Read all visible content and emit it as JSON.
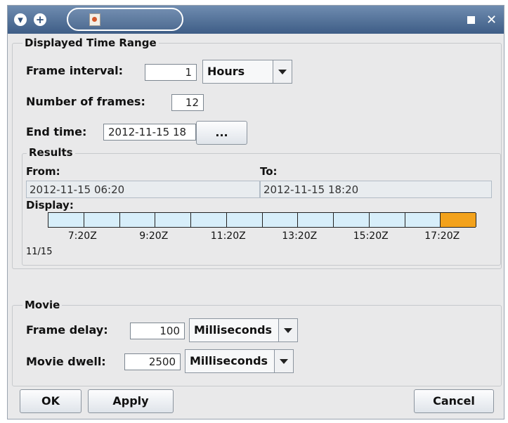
{
  "window": {
    "title": "",
    "icons": [
      "collapse-icon",
      "plus-icon",
      "java-app-icon",
      "minimize-icon",
      "close-icon"
    ],
    "titlebar_colors": [
      "#6f8cb0",
      "#3e5d86"
    ]
  },
  "time_range": {
    "legend": "Displayed Time Range",
    "frame_interval": {
      "label": "Frame interval:",
      "value": "1",
      "unit": "Hours"
    },
    "number_of_frames": {
      "label": "Number of frames:",
      "value": "12"
    },
    "end_time": {
      "label": "End time:",
      "value": "2012-11-15 18",
      "picker_label": "..."
    }
  },
  "results": {
    "legend": "Results",
    "from_label": "From:",
    "to_label": "To:",
    "from_value": "2012-11-15 06:20",
    "to_value": "2012-11-15 18:20",
    "display_label": "Display:",
    "timeline": {
      "frame_count": 12,
      "current_frame": 12,
      "ticks": [
        "7:20Z",
        "9:20Z",
        "11:20Z",
        "13:20Z",
        "15:20Z",
        "17:20Z"
      ],
      "date": "11/15",
      "colors": {
        "frame": "#d7eefa",
        "current": "#f3a21c"
      }
    }
  },
  "movie": {
    "legend": "Movie",
    "frame_delay": {
      "label": "Frame delay:",
      "value": "100",
      "unit": "Milliseconds"
    },
    "movie_dwell": {
      "label": "Movie dwell:",
      "value": "2500",
      "unit": "Milliseconds"
    }
  },
  "buttons": {
    "ok": "OK",
    "apply": "Apply",
    "cancel": "Cancel"
  }
}
